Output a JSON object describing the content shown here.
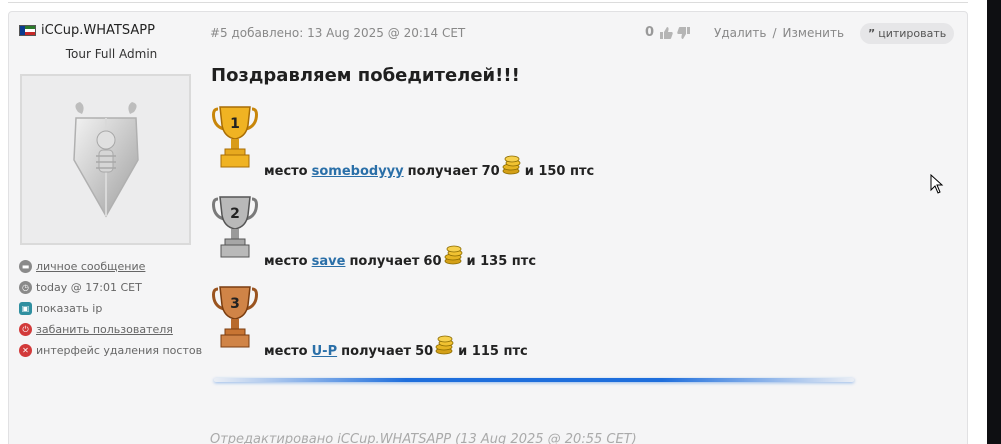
{
  "post": {
    "author": {
      "name": "iCCup.WHATSAPP",
      "title": "Tour Full Admin",
      "links": [
        {
          "label": "личное сообщение",
          "icon": "message-icon",
          "color": "#8a8a8a",
          "underline": true
        },
        {
          "label": "today @ 17:01 CET",
          "icon": "clock-icon",
          "color": "#8a8a8a",
          "underline": false
        },
        {
          "label": "показать ip",
          "icon": "ip-icon",
          "color": "#2f8fa0",
          "underline": false
        },
        {
          "label": "забанить пользователя",
          "icon": "ban-icon",
          "color": "#d23a3a",
          "underline": true
        },
        {
          "label": "интерфейс удаления постов",
          "icon": "delete-icon",
          "color": "#d23a3a",
          "underline": false
        }
      ]
    },
    "meta": "#5 добавлено: 13 Aug 2025 @ 20:14 CET",
    "votes": "0",
    "actions": {
      "delete": "Удалить",
      "separator": "/",
      "edit": "Изменить"
    },
    "quote": {
      "icon": "quote-icon",
      "label": "цитировать"
    },
    "heading": "Поздравляем победителей!!!",
    "winners": [
      {
        "place_number": "1",
        "trophy": "gold-trophy-icon",
        "place_label": "место",
        "name": "somebodyyy",
        "gets": "получает",
        "gold": "70",
        "pts": "и 150 птс"
      },
      {
        "place_number": "2",
        "trophy": "silver-trophy-icon",
        "place_label": "место",
        "name": "save",
        "gets": "получает",
        "gold": "60",
        "pts": "и 135 птс"
      },
      {
        "place_number": "3",
        "trophy": "bronze-trophy-icon",
        "place_label": "место",
        "name": "U-P",
        "gets": "получает",
        "gold": "50",
        "pts": "и 115 птс"
      }
    ],
    "edited": "Отредактировано iCCup.WHATSAPP (13 Aug 2025 @ 20:55 CET)"
  },
  "colors": {
    "link": "#2a6fa8",
    "divider": "#1e6edc",
    "gold": "#e0a21c",
    "silver": "#a6a6a6",
    "bronze": "#c87533"
  }
}
